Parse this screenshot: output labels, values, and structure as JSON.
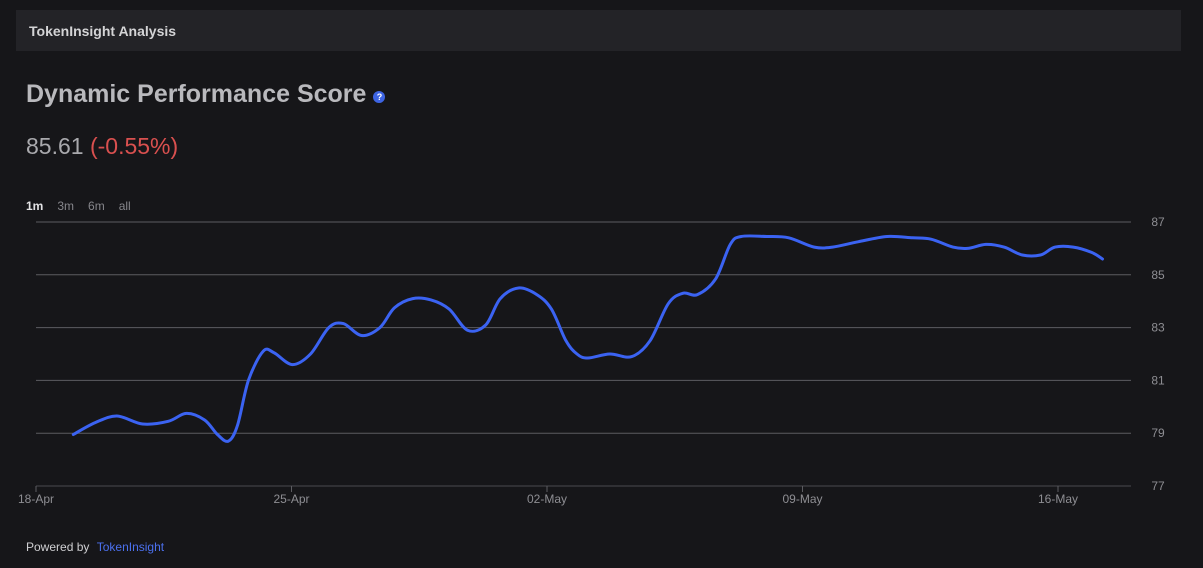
{
  "header": {
    "title": "TokenInsight Analysis"
  },
  "score": {
    "title": "Dynamic Performance Score",
    "help_icon": "question-circle-icon",
    "value": "85.61",
    "change": "(-0.55%)"
  },
  "ranges": [
    {
      "label": "1m",
      "active": true
    },
    {
      "label": "3m",
      "active": false
    },
    {
      "label": "6m",
      "active": false
    },
    {
      "label": "all",
      "active": false
    }
  ],
  "colors": {
    "line": "#3b63f2",
    "change_negative": "#d9504f",
    "link": "#4b70ee"
  },
  "chart_data": {
    "type": "line",
    "ylim": [
      77,
      87
    ],
    "y_ticks": [
      "77",
      "79",
      "81",
      "83",
      "85",
      "87"
    ],
    "x_ticks": [
      {
        "label": "18-Apr",
        "day": 0
      },
      {
        "label": "25-Apr",
        "day": 7
      },
      {
        "label": "02-May",
        "day": 14
      },
      {
        "label": "09-May",
        "day": 21
      },
      {
        "label": "16-May",
        "day": 28
      }
    ],
    "grid": true,
    "legend": "none",
    "points": [
      [
        0.5,
        78.95
      ],
      [
        1.1,
        79.4
      ],
      [
        1.7,
        79.65
      ],
      [
        2.4,
        79.35
      ],
      [
        3.1,
        79.45
      ],
      [
        3.6,
        79.75
      ],
      [
        4.1,
        79.5
      ],
      [
        4.45,
        78.95
      ],
      [
        4.75,
        78.7
      ],
      [
        5.0,
        79.3
      ],
      [
        5.3,
        81.0
      ],
      [
        5.7,
        82.1
      ],
      [
        6.0,
        82.05
      ],
      [
        6.5,
        81.6
      ],
      [
        7.0,
        82.0
      ],
      [
        7.5,
        83.0
      ],
      [
        7.9,
        83.15
      ],
      [
        8.4,
        82.7
      ],
      [
        8.9,
        83.0
      ],
      [
        9.3,
        83.75
      ],
      [
        9.8,
        84.1
      ],
      [
        10.3,
        84.05
      ],
      [
        10.8,
        83.7
      ],
      [
        11.3,
        82.9
      ],
      [
        11.8,
        83.1
      ],
      [
        12.2,
        84.1
      ],
      [
        12.7,
        84.5
      ],
      [
        13.2,
        84.25
      ],
      [
        13.6,
        83.7
      ],
      [
        14.0,
        82.5
      ],
      [
        14.3,
        82.0
      ],
      [
        14.6,
        81.85
      ],
      [
        15.2,
        82.0
      ],
      [
        15.8,
        81.9
      ],
      [
        16.3,
        82.5
      ],
      [
        16.8,
        83.9
      ],
      [
        17.2,
        84.3
      ],
      [
        17.6,
        84.25
      ],
      [
        18.1,
        84.85
      ],
      [
        18.5,
        86.15
      ],
      [
        18.8,
        86.45
      ],
      [
        19.5,
        86.45
      ],
      [
        20.1,
        86.4
      ],
      [
        20.8,
        86.05
      ],
      [
        21.3,
        86.05
      ],
      [
        22.0,
        86.25
      ],
      [
        22.8,
        86.45
      ],
      [
        23.5,
        86.4
      ],
      [
        24.0,
        86.35
      ],
      [
        24.6,
        86.05
      ],
      [
        25.0,
        86.0
      ],
      [
        25.5,
        86.15
      ],
      [
        26.0,
        86.05
      ],
      [
        26.5,
        85.75
      ],
      [
        27.0,
        85.75
      ],
      [
        27.4,
        86.05
      ],
      [
        27.9,
        86.05
      ],
      [
        28.4,
        85.85
      ],
      [
        28.7,
        85.6
      ]
    ]
  },
  "footer": {
    "label": "Powered by",
    "link": "TokenInsight"
  }
}
